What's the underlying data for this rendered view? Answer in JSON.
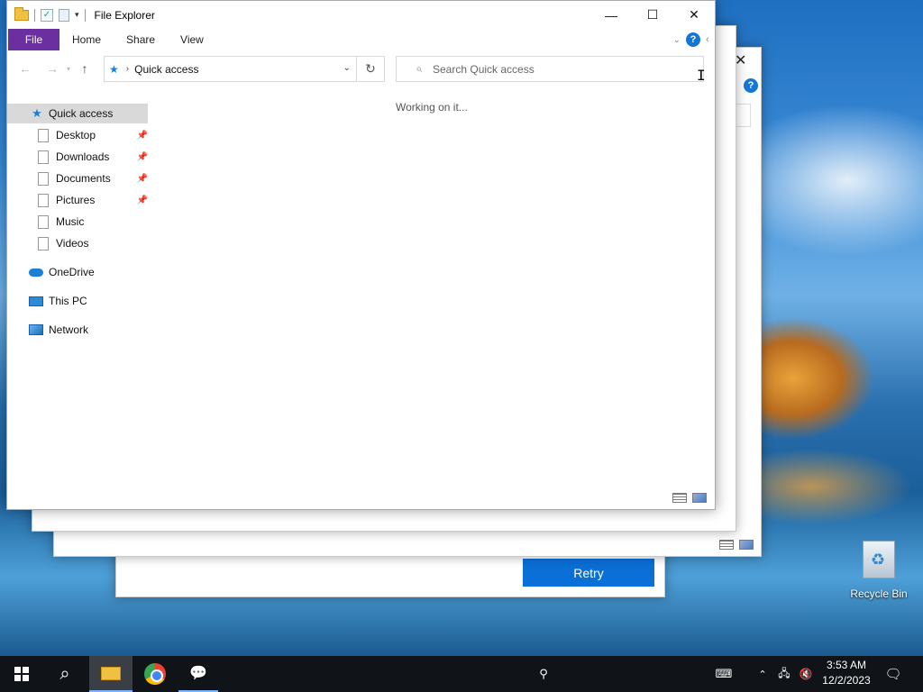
{
  "window": {
    "title": "File Explorer",
    "minimize": "—",
    "maximize": "☐",
    "close": "✕"
  },
  "ribbon": {
    "tabs": [
      "File",
      "Home",
      "Share",
      "View"
    ],
    "help": "?"
  },
  "navigation": {
    "back": "←",
    "forward": "→",
    "recent": "▾",
    "up": "↑",
    "address_separator": "›",
    "address": "Quick access",
    "refresh": "↻",
    "search_placeholder": "Search Quick access"
  },
  "sidebar": {
    "quick_access": "Quick access",
    "pinned": [
      {
        "label": "Desktop",
        "pinned": true
      },
      {
        "label": "Downloads",
        "pinned": true
      },
      {
        "label": "Documents",
        "pinned": true
      },
      {
        "label": "Pictures",
        "pinned": true
      },
      {
        "label": "Music",
        "pinned": false
      },
      {
        "label": "Videos",
        "pinned": false
      }
    ],
    "onedrive": "OneDrive",
    "this_pc": "This PC",
    "network": "Network"
  },
  "content": {
    "status": "Working on it..."
  },
  "background_dialog": {
    "retry_label": "Retry"
  },
  "desktop": {
    "recycle_bin": "Recycle Bin"
  },
  "taskbar": {
    "clock_time": "3:53 AM",
    "clock_date": "12/2/2023"
  }
}
